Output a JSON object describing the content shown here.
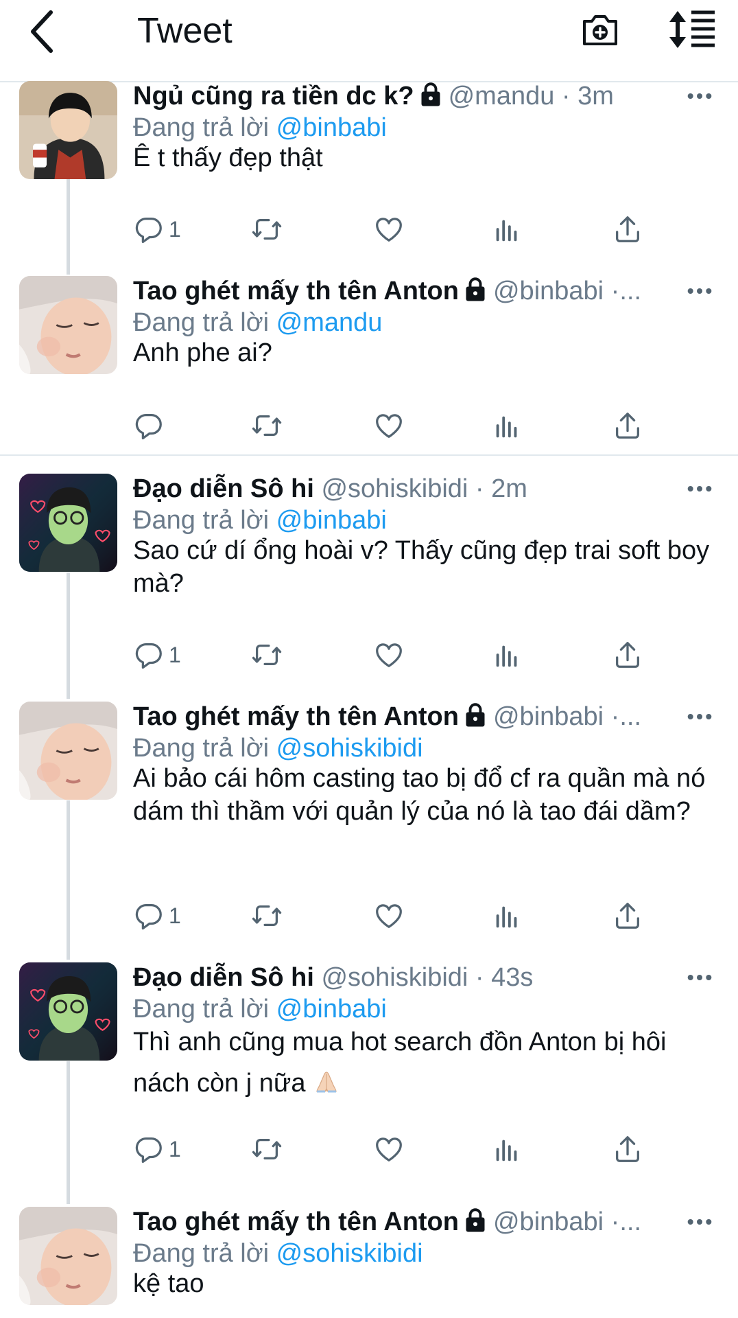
{
  "app": {
    "title": "Tweet"
  },
  "tweets": [
    {
      "name": "Ngủ cũng ra tiền dc k?",
      "handle": "@mandu · 3m",
      "reply_prefix": "Đang trả lời",
      "reply_to": "@binbabi",
      "text": "Ê t thấy đẹp thật",
      "reply_count": "1"
    },
    {
      "name": "Tao ghét mấy th tên Anton",
      "handle": "@binbabi ·...",
      "reply_prefix": "Đang trả lời",
      "reply_to": "@mandu",
      "text": "Anh phe ai?",
      "reply_count": ""
    },
    {
      "name": "Đạo diễn Sô hi",
      "handle": "@sohiskibidi · 2m",
      "reply_prefix": "Đang trả lời",
      "reply_to": "@binbabi",
      "text": "Sao cứ dí ổng hoài v? Thấy cũng đẹp trai soft boy mà?",
      "reply_count": "1"
    },
    {
      "name": "Tao ghét mấy th tên Anton",
      "handle": "@binbabi ·...",
      "reply_prefix": "Đang trả lời",
      "reply_to": "@sohiskibidi",
      "text": "Ai bảo cái hôm casting tao bị đổ cf ra quần mà nó dám thì thầm với quản lý của nó là tao đái dầm?",
      "reply_count": "1"
    },
    {
      "name": "Đạo diễn Sô hi",
      "handle": "@sohiskibidi · 43s",
      "reply_prefix": "Đang trả lời",
      "reply_to": "@binbabi",
      "text": "Thì anh cũng mua hot search đồn Anton bị hôi nách còn j nữa",
      "reply_count": "1"
    },
    {
      "name": "Tao ghét mấy th tên Anton",
      "handle": "@binbabi ·...",
      "reply_prefix": "Đang trả lời",
      "reply_to": "@sohiskibidi",
      "text": "kệ tao",
      "reply_count": ""
    }
  ],
  "colors": {
    "link": "#1d9bf0",
    "secondary": "#6b7b8b",
    "text": "#0f1419"
  },
  "icons": [
    "back-arrow-icon",
    "camera-add-icon",
    "sort-icon",
    "lock-icon",
    "more-icon",
    "reply-icon",
    "retweet-icon",
    "like-icon",
    "views-icon",
    "share-icon",
    "folded-hands-emoji"
  ]
}
